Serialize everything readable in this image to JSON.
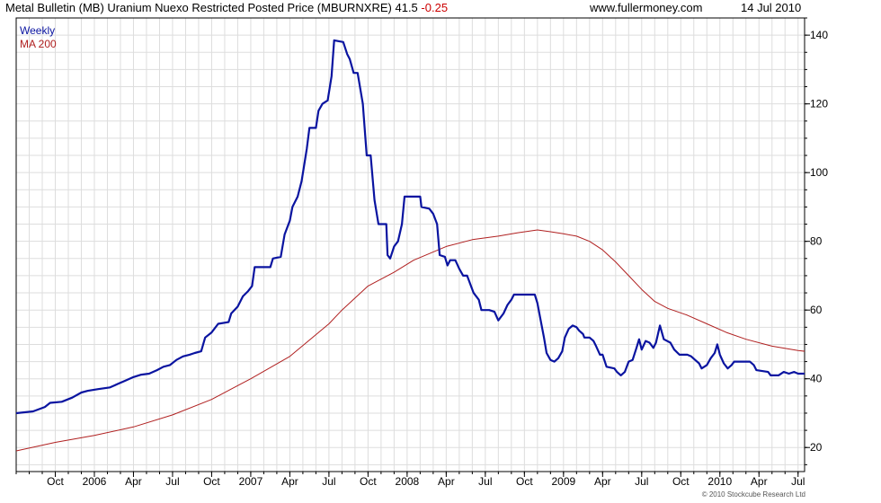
{
  "header": {
    "title": "Metal Bulletin (MB) Uranium Nuexo Restricted Posted Price (MBURNXRE)",
    "last_value": "41.5",
    "change": "-0.25",
    "site": "www.fullermoney.com",
    "date": "14 Jul 2010"
  },
  "copyright": "© 2010 Stockcube Research Ltd",
  "colors": {
    "weekly": "#0a14a0",
    "ma200": "#b02020",
    "change": "#cc0000",
    "grid": "#dddddd",
    "axis": "#000000"
  },
  "chart_data": {
    "type": "line",
    "x_unit": "months since Jul 2005",
    "xlim": [
      0,
      60.5
    ],
    "ylim": [
      13,
      145
    ],
    "y_ticks": [
      20,
      40,
      60,
      80,
      100,
      120,
      140
    ],
    "x_tick_labels": [
      {
        "t": 3,
        "label": "Oct"
      },
      {
        "t": 6,
        "label": "2006"
      },
      {
        "t": 9,
        "label": "Apr"
      },
      {
        "t": 12,
        "label": "Jul"
      },
      {
        "t": 15,
        "label": "Oct"
      },
      {
        "t": 18,
        "label": "2007"
      },
      {
        "t": 21,
        "label": "Apr"
      },
      {
        "t": 24,
        "label": "Jul"
      },
      {
        "t": 27,
        "label": "Oct"
      },
      {
        "t": 30,
        "label": "2008"
      },
      {
        "t": 33,
        "label": "Apr"
      },
      {
        "t": 36,
        "label": "Jul"
      },
      {
        "t": 39,
        "label": "Oct"
      },
      {
        "t": 42,
        "label": "2009"
      },
      {
        "t": 45,
        "label": "Apr"
      },
      {
        "t": 48,
        "label": "Jul"
      },
      {
        "t": 51,
        "label": "Oct"
      },
      {
        "t": 54,
        "label": "2010"
      },
      {
        "t": 57,
        "label": "Apr"
      },
      {
        "t": 60,
        "label": "Jul"
      }
    ],
    "grid": true,
    "legend": "top-left",
    "series": [
      {
        "name": "Weekly",
        "color": "#0a14a0",
        "points": [
          [
            0,
            30
          ],
          [
            1.3,
            30.5
          ],
          [
            2.2,
            31.8
          ],
          [
            2.6,
            33
          ],
          [
            3.5,
            33.3
          ],
          [
            4.3,
            34.5
          ],
          [
            5,
            36
          ],
          [
            5.5,
            36.5
          ],
          [
            6.3,
            37
          ],
          [
            7.2,
            37.5
          ],
          [
            7.8,
            38.5
          ],
          [
            8.4,
            39.5
          ],
          [
            9,
            40.5
          ],
          [
            9.6,
            41.2
          ],
          [
            10.2,
            41.5
          ],
          [
            10.8,
            42.5
          ],
          [
            11.3,
            43.5
          ],
          [
            11.8,
            44
          ],
          [
            12.3,
            45.5
          ],
          [
            12.8,
            46.5
          ],
          [
            13.3,
            47
          ],
          [
            13.7,
            47.5
          ],
          [
            14.2,
            48
          ],
          [
            14.5,
            52
          ],
          [
            15,
            53.5
          ],
          [
            15.5,
            56
          ],
          [
            16.3,
            56.5
          ],
          [
            16.5,
            59
          ],
          [
            17,
            61
          ],
          [
            17.4,
            64
          ],
          [
            17.8,
            65.5
          ],
          [
            18.1,
            67
          ],
          [
            18.3,
            72.5
          ],
          [
            19.5,
            72.5
          ],
          [
            19.7,
            75
          ],
          [
            20.3,
            75.5
          ],
          [
            20.6,
            82
          ],
          [
            21,
            86
          ],
          [
            21.2,
            90
          ],
          [
            21.6,
            93
          ],
          [
            21.9,
            97.5
          ],
          [
            22.3,
            107
          ],
          [
            22.5,
            113
          ],
          [
            23,
            113
          ],
          [
            23.2,
            118
          ],
          [
            23.5,
            120
          ],
          [
            23.9,
            121
          ],
          [
            24.2,
            128
          ],
          [
            24.4,
            138.5
          ],
          [
            25.1,
            138
          ],
          [
            25.4,
            134.5
          ],
          [
            25.6,
            133
          ],
          [
            25.9,
            129
          ],
          [
            26.2,
            129
          ],
          [
            26.6,
            120
          ],
          [
            26.9,
            105
          ],
          [
            27.2,
            105
          ],
          [
            27.5,
            92
          ],
          [
            27.8,
            85
          ],
          [
            28.4,
            85
          ],
          [
            28.5,
            76
          ],
          [
            28.7,
            75
          ],
          [
            29,
            78.5
          ],
          [
            29.3,
            80
          ],
          [
            29.6,
            85
          ],
          [
            29.8,
            93
          ],
          [
            31,
            93
          ],
          [
            31.1,
            90
          ],
          [
            31.7,
            89.5
          ],
          [
            32,
            88
          ],
          [
            32.3,
            85
          ],
          [
            32.5,
            76
          ],
          [
            32.9,
            75.5
          ],
          [
            33.1,
            73
          ],
          [
            33.3,
            74.5
          ],
          [
            33.7,
            74.5
          ],
          [
            34,
            72
          ],
          [
            34.3,
            70
          ],
          [
            34.6,
            70
          ],
          [
            34.9,
            67
          ],
          [
            35.1,
            65
          ],
          [
            35.5,
            63
          ],
          [
            35.7,
            60
          ],
          [
            36.3,
            60
          ],
          [
            36.7,
            59.5
          ],
          [
            37,
            57
          ],
          [
            37.4,
            59
          ],
          [
            37.7,
            61.5
          ],
          [
            38,
            63
          ],
          [
            38.2,
            64.5
          ],
          [
            39.8,
            64.5
          ],
          [
            40,
            62
          ],
          [
            40.2,
            58
          ],
          [
            40.5,
            52
          ],
          [
            40.7,
            47.5
          ],
          [
            41,
            45.5
          ],
          [
            41.3,
            45
          ],
          [
            41.6,
            46
          ],
          [
            41.9,
            48
          ],
          [
            42.1,
            52
          ],
          [
            42.4,
            54.5
          ],
          [
            42.7,
            55.5
          ],
          [
            43,
            55
          ],
          [
            43.2,
            54
          ],
          [
            43.5,
            53
          ],
          [
            43.6,
            52
          ],
          [
            44,
            52
          ],
          [
            44.3,
            51
          ],
          [
            44.5,
            49.5
          ],
          [
            44.8,
            47
          ],
          [
            45,
            47
          ],
          [
            45.3,
            43.5
          ],
          [
            45.9,
            43
          ],
          [
            46.1,
            42
          ],
          [
            46.4,
            41
          ],
          [
            46.7,
            42
          ],
          [
            47,
            45
          ],
          [
            47.3,
            45.5
          ],
          [
            47.6,
            49
          ],
          [
            47.8,
            51.5
          ],
          [
            48,
            48.5
          ],
          [
            48.3,
            51
          ],
          [
            48.6,
            50.5
          ],
          [
            48.9,
            49
          ],
          [
            49.1,
            50.5
          ],
          [
            49.4,
            55.5
          ],
          [
            49.7,
            51.5
          ],
          [
            50.2,
            50.5
          ],
          [
            50.5,
            48.5
          ],
          [
            50.9,
            47
          ],
          [
            51.5,
            47
          ],
          [
            51.8,
            46.5
          ],
          [
            52.1,
            45.5
          ],
          [
            52.4,
            44.5
          ],
          [
            52.6,
            43
          ],
          [
            53,
            44
          ],
          [
            53.3,
            46
          ],
          [
            53.6,
            47.5
          ],
          [
            53.8,
            50
          ],
          [
            54,
            47
          ],
          [
            54.3,
            44.5
          ],
          [
            54.6,
            43
          ],
          [
            54.9,
            44
          ],
          [
            55.1,
            45
          ],
          [
            56.3,
            45
          ],
          [
            56.6,
            44
          ],
          [
            56.8,
            42.5
          ],
          [
            57.7,
            42
          ],
          [
            57.9,
            41
          ],
          [
            58.5,
            41
          ],
          [
            58.9,
            42
          ],
          [
            59.3,
            41.5
          ],
          [
            59.7,
            42
          ],
          [
            60,
            41.5
          ],
          [
            60.5,
            41.5
          ],
          [
            61.3,
            41.3
          ],
          [
            62,
            41.5
          ],
          [
            62.5,
            42
          ]
        ]
      },
      {
        "name": "MA 200",
        "color": "#b02020",
        "points": [
          [
            0,
            19
          ],
          [
            3,
            21.5
          ],
          [
            6,
            23.5
          ],
          [
            9,
            26
          ],
          [
            12,
            29.5
          ],
          [
            15,
            34
          ],
          [
            18,
            40
          ],
          [
            21,
            46.5
          ],
          [
            24,
            56
          ],
          [
            25,
            60
          ],
          [
            27,
            67
          ],
          [
            29,
            71
          ],
          [
            30.5,
            74.5
          ],
          [
            33,
            78.5
          ],
          [
            35,
            80.5
          ],
          [
            37,
            81.5
          ],
          [
            38.5,
            82.5
          ],
          [
            40,
            83.3
          ],
          [
            41,
            82.8
          ],
          [
            42,
            82.2
          ],
          [
            43,
            81.5
          ],
          [
            44,
            80
          ],
          [
            45,
            77.5
          ],
          [
            46,
            74
          ],
          [
            47,
            70
          ],
          [
            48,
            66
          ],
          [
            49,
            62.5
          ],
          [
            50,
            60.5
          ],
          [
            51.5,
            58.5
          ],
          [
            53,
            56
          ],
          [
            54.5,
            53.5
          ],
          [
            56,
            51.5
          ],
          [
            58,
            49.5
          ],
          [
            60,
            48.2
          ],
          [
            61.5,
            47.6
          ],
          [
            62.5,
            47.2
          ]
        ]
      }
    ]
  }
}
